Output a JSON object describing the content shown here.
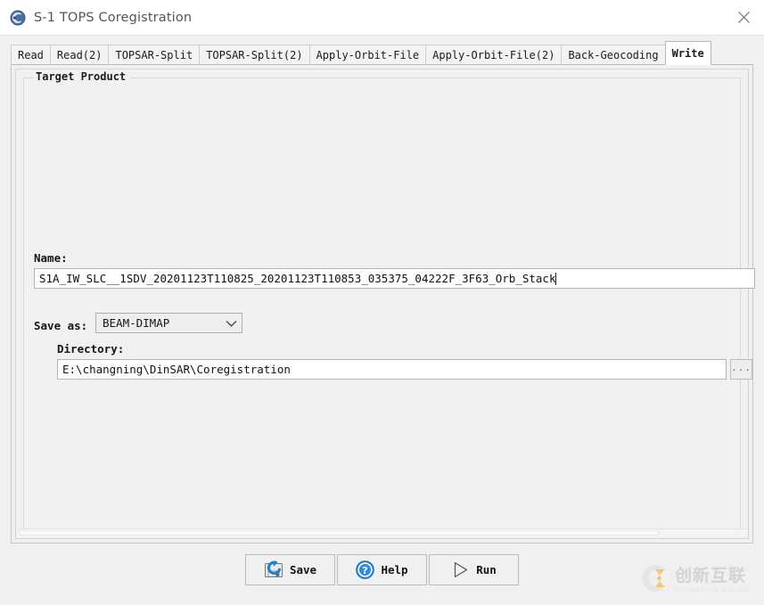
{
  "window": {
    "title": "S-1 TOPS Coregistration",
    "app_icon": "snap-app-icon",
    "close_label": "×"
  },
  "tabs": [
    {
      "label": "Read",
      "selected": false
    },
    {
      "label": "Read(2)",
      "selected": false
    },
    {
      "label": "TOPSAR-Split",
      "selected": false
    },
    {
      "label": "TOPSAR-Split(2)",
      "selected": false
    },
    {
      "label": "Apply-Orbit-File",
      "selected": false
    },
    {
      "label": "Apply-Orbit-File(2)",
      "selected": false
    },
    {
      "label": "Back-Geocoding",
      "selected": false
    },
    {
      "label": "Write",
      "selected": true
    }
  ],
  "target_product": {
    "group_title": "Target Product",
    "name_label": "Name:",
    "name_value": "S1A_IW_SLC__1SDV_20201123T110825_20201123T110853_035375_04222F_3F63_Orb_Stack",
    "save_as_label": "Save as:",
    "save_as_value": "BEAM-DIMAP",
    "save_as_options": [
      "BEAM-DIMAP"
    ],
    "directory_label": "Directory:",
    "directory_value": "E:\\changning\\DinSAR\\Coregistration",
    "browse_label": "..."
  },
  "buttons": {
    "save": {
      "label": "Save",
      "icon": "save-floppy-icon"
    },
    "help": {
      "label": "Help",
      "icon": "help-question-icon"
    },
    "run": {
      "label": "Run",
      "icon": "run-play-icon"
    }
  },
  "watermark": {
    "cn_text": "创新互联",
    "en_text": "CHUANGXIN HULIAN"
  },
  "colors": {
    "accent_blue": "#2a7fc9",
    "titlebar_bg": "#ffffff",
    "panel_bg": "#f1f1f1",
    "field_bg": "#ffffff",
    "border": "#c7c7c7"
  }
}
